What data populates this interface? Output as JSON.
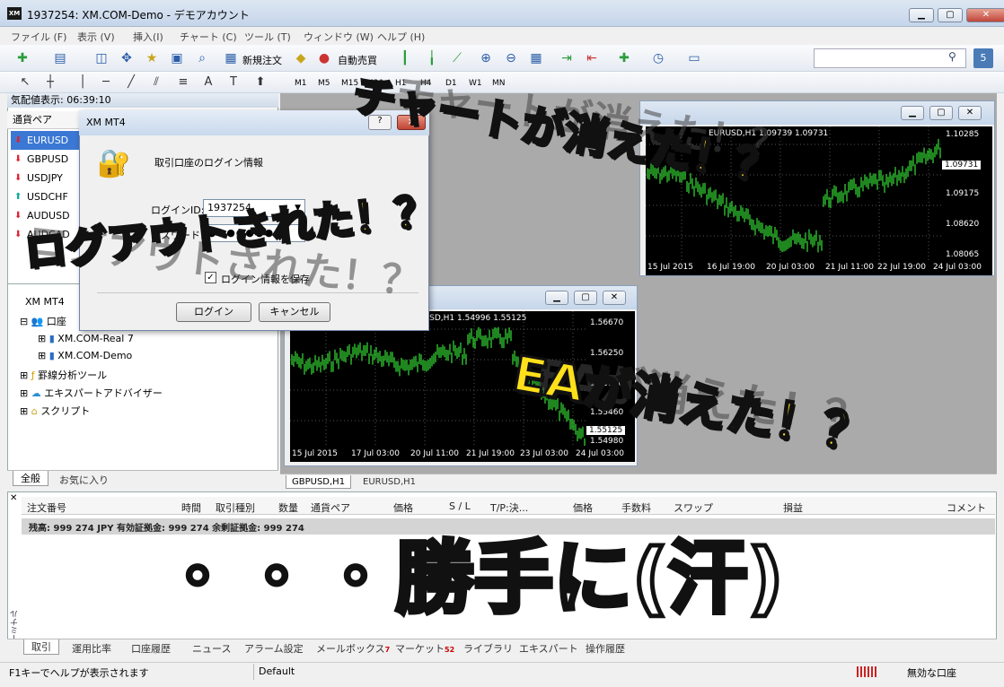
{
  "window": {
    "title": "1937254: XM.COM-Demo - デモアカウント",
    "icon_label": "XM",
    "min": "▁",
    "max": "▢",
    "close": "✕"
  },
  "menu": [
    "ファイル (F)",
    "表示 (V)",
    "挿入(I)",
    "チャート (C)",
    "ツール (T)",
    "ウィンドウ (W)",
    "ヘルプ (H)"
  ],
  "toolbar": {
    "new_order": "新規注文",
    "auto_trade": "自動売買"
  },
  "timeframes": [
    "M1",
    "M5",
    "M15",
    "M30",
    "H1",
    "H4",
    "D1",
    "W1",
    "MN"
  ],
  "market_watch": {
    "header": "気配値表示: 06:39:10",
    "column": "通貨ペア",
    "symbols": [
      {
        "name": "EURUSD",
        "dir": "down"
      },
      {
        "name": "GBPUSD",
        "dir": "down"
      },
      {
        "name": "USDJPY",
        "dir": "down"
      },
      {
        "name": "USDCHF",
        "dir": "up"
      },
      {
        "name": "AUDUSD",
        "dir": "down"
      },
      {
        "name": "AUDCAD",
        "dir": "down"
      }
    ]
  },
  "navigator": {
    "root": "XM MT4",
    "accounts": "口座",
    "account_items": [
      "XM.COM-Real 7",
      "XM.COM-Demo"
    ],
    "indicators": "罫線分析ツール",
    "experts": "エキスパートアドバイザー",
    "scripts": "スクリプト",
    "tabs": [
      "全般",
      "お気に入り"
    ]
  },
  "login_dialog": {
    "title": "XM MT4",
    "heading": "取引口座のログイン情報",
    "login_label": "ログインID:",
    "login_value": "1937254",
    "password_label": "パスワード:",
    "password_value": "●●●●●●●●",
    "save_label": "ログイン情報を保存",
    "login_button": "ログイン",
    "cancel_button": "キャンセル"
  },
  "chart1": {
    "header": "EURUSD,H1 1.09739 1.09731",
    "prices": [
      "1.10285",
      "1.09731",
      "1.09175",
      "1.08620",
      "1.08065"
    ],
    "current": "1.09731",
    "dates": [
      "15 Jul 2015",
      "16 Jul 19:00",
      "20 Jul 03:00",
      "21 Jul 11:00",
      "22 Jul 19:00",
      "24 Jul 03:00"
    ]
  },
  "chart2": {
    "header": "GBPUSD,H1 1.54996 1.55125",
    "prices": [
      "1.56670",
      "1.56250",
      "1.55840",
      "1.55460",
      "1.55125",
      "1.54980"
    ],
    "current": "1.55125",
    "dates": [
      "15 Jul 2015",
      "17 Jul 03:00",
      "20 Jul 11:00",
      "21 Jul 19:00",
      "23 Jul 03:00",
      "24 Jul 03:00"
    ]
  },
  "chart_tabs": [
    "GBPUSD,H1",
    "EURUSD,H1"
  ],
  "terminal": {
    "columns": [
      "注文番号",
      "時間",
      "取引種別",
      "数量",
      "通貨ペア",
      "価格",
      "S / L",
      "T/P:決...",
      "価格",
      "手数料",
      "スワップ",
      "損益",
      "コメント"
    ],
    "balance": "残高: 999 274 JPY  有効証拠金: 999 274  余剰証拠金: 999 274",
    "side_label": "ターミナル",
    "tabs": [
      {
        "label": "取引"
      },
      {
        "label": "運用比率"
      },
      {
        "label": "口座履歴"
      },
      {
        "label": "ニュース"
      },
      {
        "label": "アラーム設定"
      },
      {
        "label": "メールボックス",
        "badge": "7"
      },
      {
        "label": "マーケット",
        "badge": "52"
      },
      {
        "label": "ライブラリ"
      },
      {
        "label": "エキスパート"
      },
      {
        "label": "操作履歴"
      }
    ]
  },
  "status": {
    "help": "F1キーでヘルプが表示されます",
    "profile": "Default",
    "connection": "無効な口座"
  },
  "overlay": {
    "chart_gone": "チャートが消えた！？",
    "logged_out": "ログアウトされた！？",
    "ea_gone": "EAが消えた！？",
    "on_its_own": "・・・勝手に(汗)"
  },
  "colors": {
    "bull": "#2fbf2f",
    "bear": "#2fbf2f",
    "bg": "#000000",
    "overlay": "#ffe01a"
  }
}
